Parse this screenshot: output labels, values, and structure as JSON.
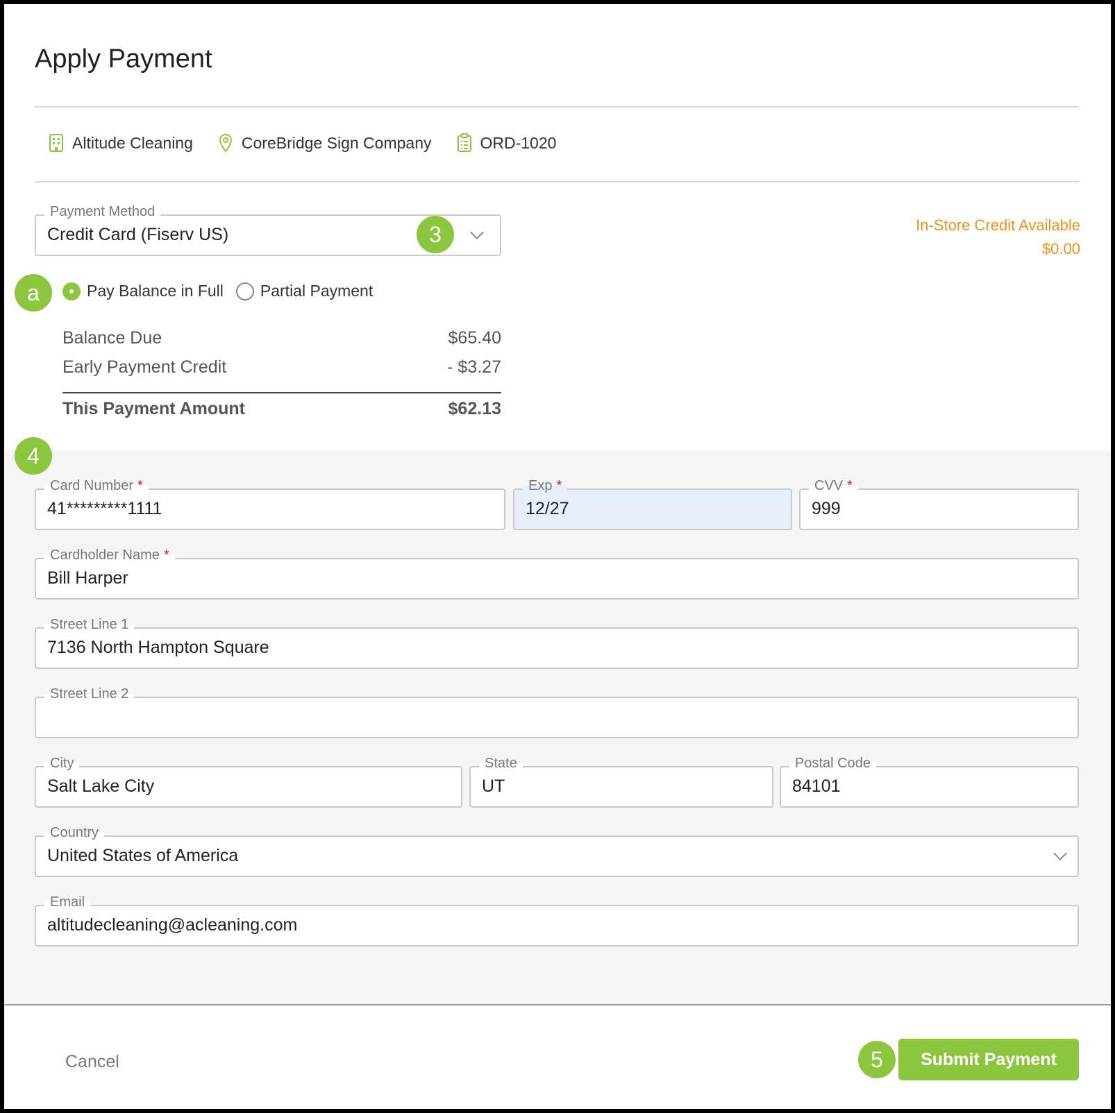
{
  "title": "Apply Payment",
  "meta": {
    "company": "Altitude Cleaning",
    "location": "CoreBridge Sign Company",
    "order": "ORD-1020",
    "icons": [
      "building-icon",
      "map-pin-icon",
      "clipboard-icon"
    ]
  },
  "payment_method": {
    "label": "Payment Method",
    "value": "Credit Card (Fiserv US)"
  },
  "in_store_credit": {
    "label": "In-Store Credit Available",
    "amount": "$0.00"
  },
  "payment_options": [
    {
      "label": "Pay Balance in Full",
      "selected": true
    },
    {
      "label": "Partial Payment",
      "selected": false
    }
  ],
  "summary": {
    "balance_due_label": "Balance Due",
    "balance_due": "$65.40",
    "early_credit_label": "Early Payment Credit",
    "early_credit": "- $3.27",
    "payment_amount_label": "This Payment Amount",
    "payment_amount": "$62.13"
  },
  "card": {
    "number_label": "Card Number",
    "number": "41*********1111",
    "exp_label": "Exp",
    "exp": "12/27",
    "cvv_label": "CVV",
    "cvv": "999",
    "required_mark": "*"
  },
  "cardholder": {
    "label": "Cardholder Name",
    "value": "Bill Harper"
  },
  "address": {
    "street1_label": "Street Line 1",
    "street1": "7136 North Hampton Square",
    "street2_label": "Street Line 2",
    "street2": "",
    "city_label": "City",
    "city": "Salt Lake City",
    "state_label": "State",
    "state": "UT",
    "postal_label": "Postal Code",
    "postal": "84101",
    "country_label": "Country",
    "country": "United States of America"
  },
  "email": {
    "label": "Email",
    "value": "altitudecleaning@acleaning.com"
  },
  "buttons": {
    "cancel": "Cancel",
    "submit": "Submit Payment"
  },
  "badges": {
    "b3": "3",
    "ba": "a",
    "b4": "4",
    "b5": "5"
  },
  "colors": {
    "accent": "#8cc63f",
    "credit": "#f39019",
    "required": "#c0272d",
    "autofill": "#e8effc"
  }
}
